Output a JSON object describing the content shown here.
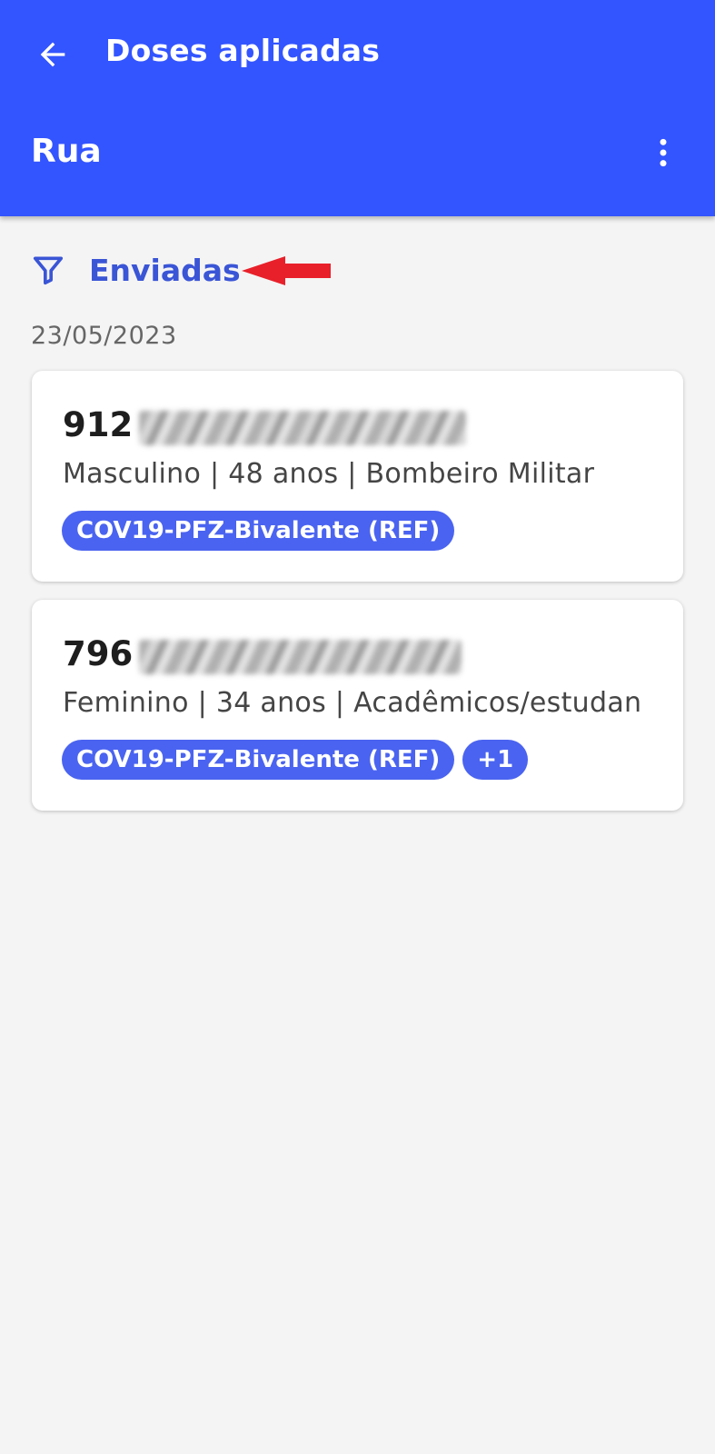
{
  "appbar": {
    "title": "Doses aplicadas",
    "location": "Rua",
    "icons": {
      "back": "arrow-left-icon",
      "more": "more-vertical-icon"
    },
    "background_color": "#3355ff"
  },
  "filter": {
    "label": "Enviadas",
    "icon": "filter-icon",
    "color": "#3a55d6"
  },
  "annotation": {
    "icon": "red-arrow-pointer",
    "color": "#e8202a"
  },
  "groups": [
    {
      "date": "23/05/2023",
      "records": [
        {
          "name_visible": "912",
          "info": "Masculino | 48 anos | Bombeiro Militar",
          "chips": [
            "COV19-PFZ-Bivalente (REF)"
          ]
        },
        {
          "name_visible": "796",
          "info": "Feminino | 34 anos | Acadêmicos/estudan",
          "chips": [
            "COV19-PFZ-Bivalente (REF)",
            "+1"
          ]
        }
      ]
    }
  ],
  "colors": {
    "chip": "#4a63f0",
    "background": "#f4f4f4"
  }
}
